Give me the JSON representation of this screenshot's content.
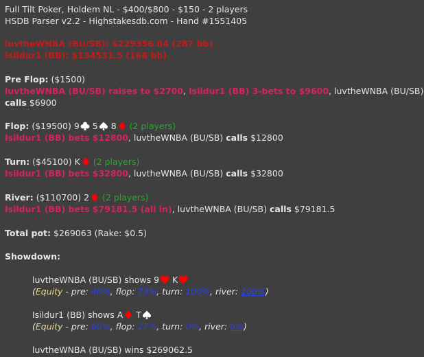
{
  "header": {
    "line1": "Full Tilt Poker, Holdem NL - $400/$800 - $150 - 2 players",
    "line2": "HSDB Parser v2.2 - Highstakesdb.com - Hand #1551405"
  },
  "stacks": {
    "p1": "luvtheWNBA (BU/SB): $229356.84 (287 bb)",
    "p2": "Isildur1 (BB): $134531.5 (168 bb)"
  },
  "preflop": {
    "label": "Pre Flop:",
    "pot": "($1500)",
    "a1": "luvtheWNBA (BU/SB) raises to $2700",
    "sep1": ",",
    "a2": "Isildur1 (BB) 3-bets to $9600",
    "sep2": ",",
    "a3_name": "luvtheWNBA (BU/SB)",
    "a3_verb": "calls",
    "a3_amt": "$6900"
  },
  "flop": {
    "label": "Flop:",
    "pot": "($19500)",
    "c1": "9",
    "c1_suit": "club",
    "c2": "5",
    "c2_suit": "spade",
    "c3": "8",
    "c3_suit": "diamond",
    "players": "(2 players)",
    "a1": "Isildur1 (BB) bets $12800",
    "sep": ",",
    "a2_name": "luvtheWNBA (BU/SB)",
    "a2_verb": "calls",
    "a2_amt": "$12800"
  },
  "turn": {
    "label": "Turn:",
    "pot": "($45100)",
    "c1": "K",
    "c1_suit": "diamond",
    "players": "(2 players)",
    "a1": "Isildur1 (BB) bets $32800",
    "sep": ",",
    "a2_name": "luvtheWNBA (BU/SB)",
    "a2_verb": "calls",
    "a2_amt": "$32800"
  },
  "river": {
    "label": "River:",
    "pot": "($110700)",
    "c1": "2",
    "c1_suit": "diamond",
    "players": "(2 players)",
    "a1": "Isildur1 (BB) bets $79181.5 (all in)",
    "sep": ",",
    "a2_name": "luvtheWNBA (BU/SB)",
    "a2_verb": "calls",
    "a2_amt": "$79181.5"
  },
  "total": {
    "label": "Total pot:",
    "value": "$269063 (Rake: $0.5)"
  },
  "showdown": {
    "label": "Showdown:",
    "p1_shows": "luvtheWNBA (BU/SB) shows",
    "p1_c1": "9",
    "p1_c1_suit": "heart",
    "p1_c2": "K",
    "p1_c2_suit": "heart",
    "p1_eq": {
      "open": "(",
      "label": "Equity",
      "pre_label": " - pre:",
      "pre": "40%",
      "flop_label": ", flop:",
      "flop": "73%",
      "turn_label": ", turn:",
      "turn": "100%",
      "river_label": ", river:",
      "river": "100%",
      "close": ")"
    },
    "p2_shows": "Isildur1 (BB) shows",
    "p2_c1": "A",
    "p2_c1_suit": "diamond",
    "p2_c2": "T",
    "p2_c2_suit": "spade",
    "p2_eq": {
      "open": "(",
      "label": "Equity",
      "pre_label": " - pre:",
      "pre": "60%",
      "flop_label": ", flop:",
      "flop": "27%",
      "turn_label": ", turn:",
      "turn": "0%",
      "river_label": ", river:",
      "river": "0%",
      "close": ")"
    },
    "winner": "luvtheWNBA (BU/SB) wins $269062.5"
  },
  "colors": {
    "background": "#3f3f3f",
    "heading_red": "#c41a1a",
    "action_pink": "#d4245c",
    "players_green": "#29a829",
    "equity_yellow": "#e8d98a",
    "equity_blue": "#2f3fe0",
    "red_suit": "#ff0000",
    "black_suit": "#ffffff"
  }
}
